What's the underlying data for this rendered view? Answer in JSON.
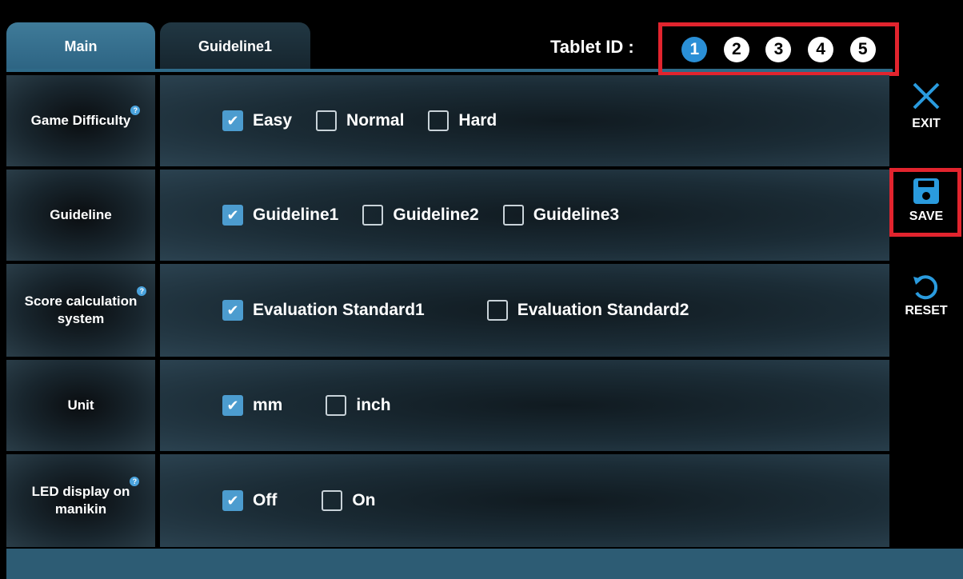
{
  "tabs": [
    {
      "label": "Main",
      "active": true
    },
    {
      "label": "Guideline1",
      "active": false
    }
  ],
  "tablet": {
    "label": "Tablet ID :",
    "ids": [
      "1",
      "2",
      "3",
      "4",
      "5"
    ],
    "active_index": 0
  },
  "rows": [
    {
      "label_lines": [
        "Game Difficulty"
      ],
      "help": true,
      "options": [
        {
          "label": "Easy",
          "checked": true
        },
        {
          "label": "Normal",
          "checked": false
        },
        {
          "label": "Hard",
          "checked": false
        }
      ]
    },
    {
      "label_lines": [
        "Guideline"
      ],
      "help": false,
      "options": [
        {
          "label": "Guideline1",
          "checked": true
        },
        {
          "label": "Guideline2",
          "checked": false
        },
        {
          "label": "Guideline3",
          "checked": false
        }
      ]
    },
    {
      "label_lines": [
        "Score calculation",
        "system"
      ],
      "help": true,
      "options": [
        {
          "label": "Evaluation Standard1",
          "checked": true
        },
        {
          "label": "Evaluation Standard2",
          "checked": false
        }
      ]
    },
    {
      "label_lines": [
        "Unit"
      ],
      "help": false,
      "options": [
        {
          "label": "mm",
          "checked": true
        },
        {
          "label": "inch",
          "checked": false
        }
      ]
    },
    {
      "label_lines": [
        "LED display on",
        "manikin"
      ],
      "help": true,
      "options": [
        {
          "label": "Off",
          "checked": true
        },
        {
          "label": "On",
          "checked": false
        }
      ]
    }
  ],
  "actions": {
    "exit_label": "EXIT",
    "save_label": "SAVE",
    "reset_label": "RESET"
  },
  "colors": {
    "accent": "#4c9ccf",
    "highlight": "#e2242e",
    "active_tab": "#2d6483"
  }
}
